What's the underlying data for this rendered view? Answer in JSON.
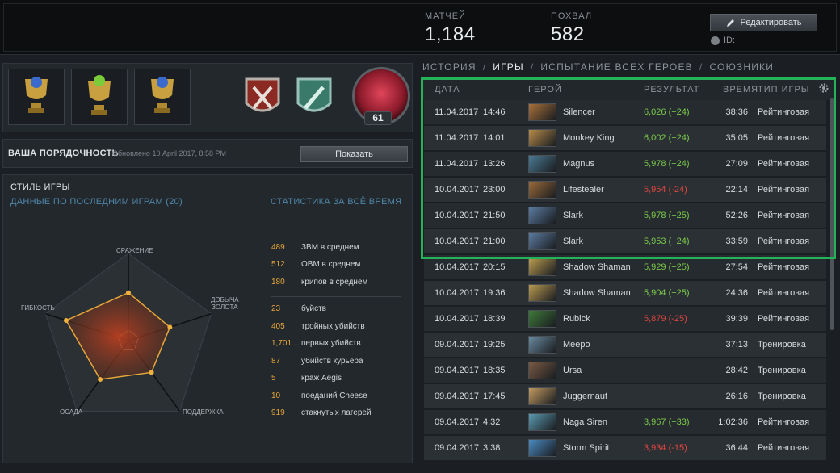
{
  "header": {
    "matches_label": "МАТЧЕЙ",
    "matches_value": "1,184",
    "commends_label": "ПОХВАЛ",
    "commends_value": "582",
    "edit_label": "Редактировать",
    "id_label": "ID:"
  },
  "profile": {
    "level": "61",
    "decency_title": "ВАША ПОРЯДОЧНОСТЬ",
    "decency_updated": "Обновлено 10 April 2017, 8:58 PM",
    "show_label": "Показать"
  },
  "playstyle": {
    "title": "СТИЛЬ ИГРЫ",
    "recent_label": "ДАННЫЕ ПО ПОСЛЕДНИМ ИГРАМ (20)",
    "alltime_label": "СТАТИСТИКА ЗА ВСЁ ВРЕМЯ",
    "axes": {
      "fight": "СРАЖЕНИЕ",
      "farm_line1": "ДОБЫЧА",
      "farm_line2": "ЗОЛОТА",
      "support": "ПОДДЕРЖКА",
      "push": "ОСАДА",
      "versatility": "ГИБКОСТЬ"
    },
    "radar_values": [
      0.55,
      0.5,
      0.45,
      0.55,
      0.75
    ],
    "stats_top": [
      {
        "value": "489",
        "label": "ЗВМ в среднем"
      },
      {
        "value": "512",
        "label": "ОВМ в среднем"
      },
      {
        "value": "180",
        "label": "крипов в среднем"
      }
    ],
    "stats_bottom": [
      {
        "value": "23",
        "label": "буйств"
      },
      {
        "value": "405",
        "label": "тройных убийств"
      },
      {
        "value": "1,701...",
        "label": "первых убийств"
      },
      {
        "value": "87",
        "label": "убийств курьера"
      },
      {
        "value": "5",
        "label": "краж Aegis"
      },
      {
        "value": "10",
        "label": "поеданий Cheese"
      },
      {
        "value": "919",
        "label": "стакнутых лагерей"
      }
    ]
  },
  "tabs": [
    {
      "label": "ИСТОРИЯ"
    },
    {
      "label": "ИГРЫ"
    },
    {
      "label": "ИСПЫТАНИЕ ВСЕХ ГЕРОЕВ"
    },
    {
      "label": "СОЮЗНИКИ"
    }
  ],
  "table": {
    "headers": {
      "date": "ДАТА",
      "hero": "ГЕРОЙ",
      "result": "РЕЗУЛЬТАТ",
      "duration": "ВРЕМЯ",
      "type": "ТИП ИГРЫ"
    },
    "rows": [
      {
        "date": "11.04.2017",
        "time": "14:46",
        "hero": "Silencer",
        "result": "6,026 (+24)",
        "result_color": "g",
        "duration": "38:36",
        "type": "Рейтинговая",
        "portrait": "#a8703a"
      },
      {
        "date": "11.04.2017",
        "time": "14:01",
        "hero": "Monkey King",
        "result": "6,002 (+24)",
        "result_color": "g",
        "duration": "35:05",
        "type": "Рейтинговая",
        "portrait": "#b68a4a"
      },
      {
        "date": "11.04.2017",
        "time": "13:26",
        "hero": "Magnus",
        "result": "5,978 (+24)",
        "result_color": "g",
        "duration": "27:09",
        "type": "Рейтинговая",
        "portrait": "#4b7a94"
      },
      {
        "date": "10.04.2017",
        "time": "23:00",
        "hero": "Lifestealer",
        "result": "5,954 (-24)",
        "result_color": "r",
        "duration": "22:14",
        "type": "Рейтинговая",
        "portrait": "#9a6a3a"
      },
      {
        "date": "10.04.2017",
        "time": "21:50",
        "hero": "Slark",
        "result": "5,978 (+25)",
        "result_color": "g",
        "duration": "52:26",
        "type": "Рейтинговая",
        "portrait": "#5b7aa0"
      },
      {
        "date": "10.04.2017",
        "time": "21:00",
        "hero": "Slark",
        "result": "5,953 (+24)",
        "result_color": "g",
        "duration": "33:59",
        "type": "Рейтинговая",
        "portrait": "#5b7aa0"
      },
      {
        "date": "10.04.2017",
        "time": "20:15",
        "hero": "Shadow Shaman",
        "result": "5,929 (+25)",
        "result_color": "g",
        "duration": "27:54",
        "type": "Рейтинговая",
        "portrait": "#b89a50"
      },
      {
        "date": "10.04.2017",
        "time": "19:36",
        "hero": "Shadow Shaman",
        "result": "5,904 (+25)",
        "result_color": "g",
        "duration": "24:36",
        "type": "Рейтинговая",
        "portrait": "#b89a50"
      },
      {
        "date": "10.04.2017",
        "time": "18:39",
        "hero": "Rubick",
        "result": "5,879 (-25)",
        "result_color": "r",
        "duration": "39:39",
        "type": "Рейтинговая",
        "portrait": "#3e7a3a"
      },
      {
        "date": "09.04.2017",
        "time": "19:25",
        "hero": "Meepo",
        "result": "",
        "result_color": "g",
        "duration": "37:13",
        "type": "Тренировка",
        "portrait": "#6a8aa0"
      },
      {
        "date": "09.04.2017",
        "time": "18:35",
        "hero": "Ursa",
        "result": "",
        "result_color": "g",
        "duration": "28:42",
        "type": "Тренировка",
        "portrait": "#7a5a44"
      },
      {
        "date": "09.04.2017",
        "time": "17:45",
        "hero": "Juggernaut",
        "result": "",
        "result_color": "g",
        "duration": "26:16",
        "type": "Тренировка",
        "portrait": "#c09a60"
      },
      {
        "date": "09.04.2017",
        "time": "4:32",
        "hero": "Naga Siren",
        "result": "3,967 (+33)",
        "result_color": "g",
        "duration": "1:02:36",
        "type": "Рейтинговая",
        "portrait": "#5a9ab0"
      },
      {
        "date": "09.04.2017",
        "time": "3:38",
        "hero": "Storm Spirit",
        "result": "3,934 (-15)",
        "result_color": "r",
        "duration": "36:44",
        "type": "Рейтинговая",
        "portrait": "#4a8ac0"
      }
    ]
  }
}
